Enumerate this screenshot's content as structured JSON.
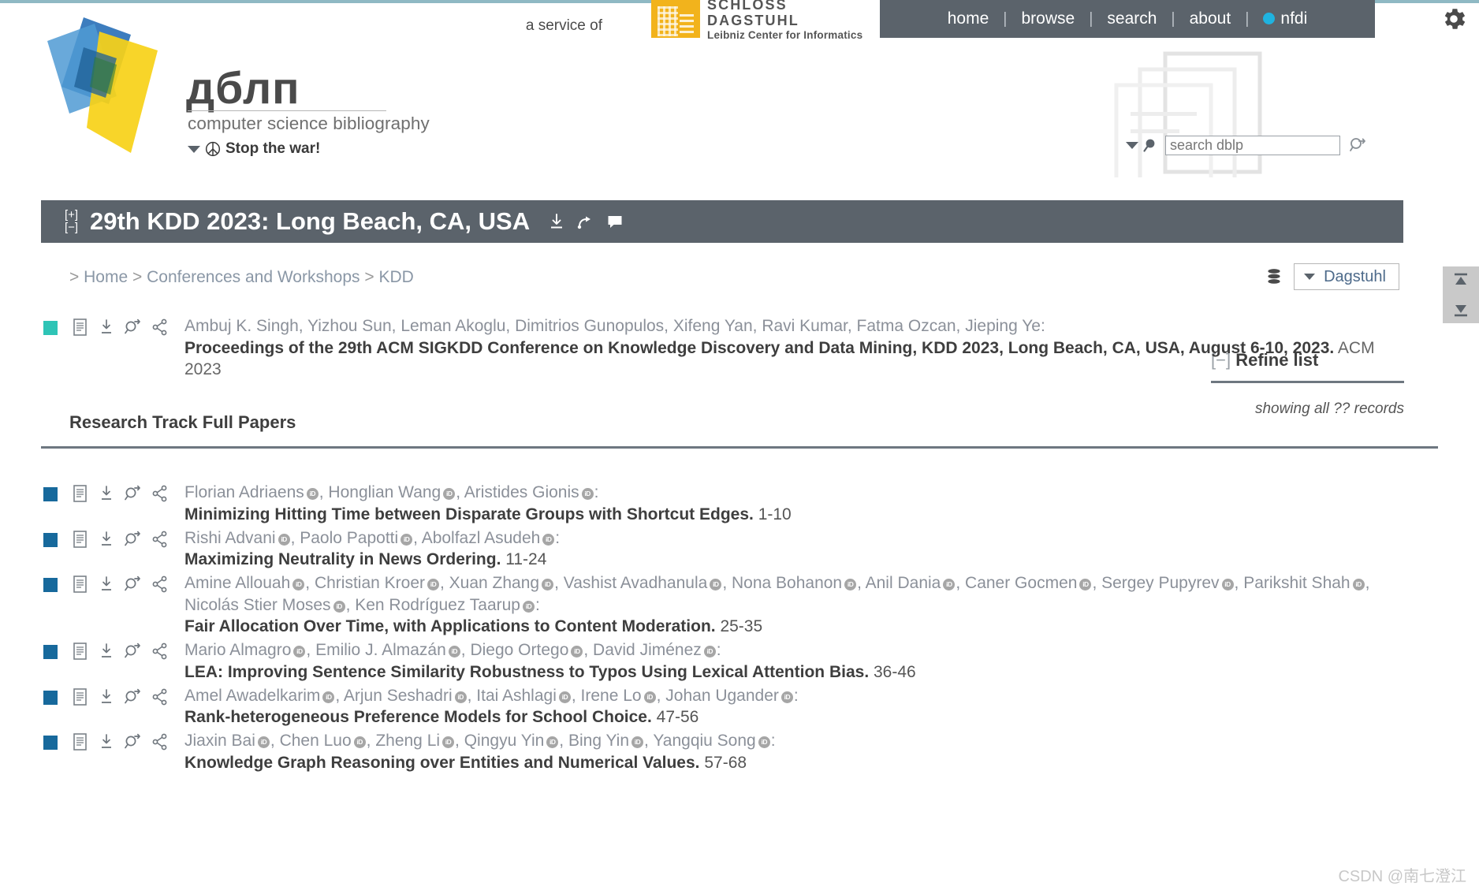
{
  "header": {
    "service_of": "a service of",
    "dagstuhl_line1": "SCHLOSS DAGSTUHL",
    "dagstuhl_line2": "Leibniz Center for Informatics",
    "nav": [
      {
        "label": "home"
      },
      {
        "label": "browse"
      },
      {
        "label": "search"
      },
      {
        "label": "about"
      },
      {
        "label": "nfdi"
      }
    ],
    "nav_separator": "|",
    "gear_icon": "gear-icon",
    "nfdi_dot_color": "#1fb3e0",
    "nav_background": "#5b636b"
  },
  "logo": {
    "wordmark": "дблп",
    "subtitle": "computer science bibliography",
    "banner": "Stop the war!"
  },
  "search": {
    "placeholder": "search dblp",
    "value": ""
  },
  "title_bar": {
    "expand": "[+]",
    "collapse": "[−]",
    "title": "29th KDD 2023: Long Beach, CA, USA",
    "icons": [
      "download-icon",
      "share-arrow-icon",
      "comment-icon"
    ],
    "background": "#5b636b"
  },
  "breadcrumb": {
    "prefix": ">",
    "items": [
      "Home",
      "Conferences and Workshops",
      "KDD"
    ],
    "separator": ">"
  },
  "db_selector": {
    "icon": "database-icon",
    "label": "Dagstuhl"
  },
  "scroll_widget": {
    "top_label": "scroll-to-top-icon",
    "bottom_label": "scroll-to-bottom-icon"
  },
  "refine_panel": {
    "toggle": "[−]",
    "title": "Refine list",
    "note": "showing all ?? records"
  },
  "section": {
    "title": "Research Track Full Papers"
  },
  "proceedings": {
    "marker_color": "#2ec4b6",
    "authors": [
      "Ambuj K. Singh",
      "Yizhou Sun",
      "Leman Akoglu",
      "Dimitrios Gunopulos",
      "Xifeng Yan",
      "Ravi Kumar",
      "Fatma Ozcan",
      "Jieping Ye"
    ],
    "authors_text": "Ambuj K. Singh, Yizhou Sun, Leman Akoglu, Dimitrios Gunopulos, Xifeng Yan, Ravi Kumar, Fatma Ozcan, Jieping Ye:",
    "title": "Proceedings of the 29th ACM SIGKDD Conference on Knowledge Discovery and Data Mining, KDD 2023, Long Beach, CA, USA, August 6-10, 2023.",
    "venue": "ACM 2023"
  },
  "entries": [
    {
      "marker_color": "#17699c",
      "authors": [
        {
          "name": "Florian Adriaens",
          "orcid": true
        },
        {
          "name": "Honglian Wang",
          "orcid": true
        },
        {
          "name": "Aristides Gionis",
          "orcid": true
        }
      ],
      "title": "Minimizing Hitting Time between Disparate Groups with Shortcut Edges.",
      "pages": "1-10"
    },
    {
      "marker_color": "#17699c",
      "authors": [
        {
          "name": "Rishi Advani",
          "orcid": true
        },
        {
          "name": "Paolo Papotti",
          "orcid": true
        },
        {
          "name": "Abolfazl Asudeh",
          "orcid": true
        }
      ],
      "title": "Maximizing Neutrality in News Ordering.",
      "pages": "11-24"
    },
    {
      "marker_color": "#17699c",
      "authors": [
        {
          "name": "Amine Allouah",
          "orcid": true
        },
        {
          "name": "Christian Kroer",
          "orcid": true
        },
        {
          "name": "Xuan Zhang",
          "orcid": true
        },
        {
          "name": "Vashist Avadhanula",
          "orcid": true
        },
        {
          "name": "Nona Bohanon",
          "orcid": true
        },
        {
          "name": "Anil Dania",
          "orcid": true
        },
        {
          "name": "Caner Gocmen",
          "orcid": true
        },
        {
          "name": "Sergey Pupyrev",
          "orcid": true
        },
        {
          "name": "Parikshit Shah",
          "orcid": true
        },
        {
          "name": "Nicolás Stier Moses",
          "orcid": true
        },
        {
          "name": "Ken Rodríguez Taarup",
          "orcid": true
        }
      ],
      "title": "Fair Allocation Over Time, with Applications to Content Moderation.",
      "pages": "25-35"
    },
    {
      "marker_color": "#17699c",
      "authors": [
        {
          "name": "Mario Almagro",
          "orcid": true
        },
        {
          "name": "Emilio J. Almazán",
          "orcid": true
        },
        {
          "name": "Diego Ortego",
          "orcid": true
        },
        {
          "name": "David Jiménez",
          "orcid": true
        }
      ],
      "title": "LEA: Improving Sentence Similarity Robustness to Typos Using Lexical Attention Bias.",
      "pages": "36-46"
    },
    {
      "marker_color": "#17699c",
      "authors": [
        {
          "name": "Amel Awadelkarim",
          "orcid": true
        },
        {
          "name": "Arjun Seshadri",
          "orcid": true
        },
        {
          "name": "Itai Ashlagi",
          "orcid": true
        },
        {
          "name": "Irene Lo",
          "orcid": true
        },
        {
          "name": "Johan Ugander",
          "orcid": true
        }
      ],
      "title": "Rank-heterogeneous Preference Models for School Choice.",
      "pages": "47-56"
    },
    {
      "marker_color": "#17699c",
      "authors": [
        {
          "name": "Jiaxin Bai",
          "orcid": true
        },
        {
          "name": "Chen Luo",
          "orcid": true
        },
        {
          "name": "Zheng Li",
          "orcid": true
        },
        {
          "name": "Qingyu Yin",
          "orcid": true
        },
        {
          "name": "Bing Yin",
          "orcid": true
        },
        {
          "name": "Yangqiu Song",
          "orcid": true
        }
      ],
      "title": "Knowledge Graph Reasoning over Entities and Numerical Values.",
      "pages": "57-68"
    }
  ],
  "entry_icons": [
    "bibtex-page-icon",
    "download-icon",
    "search-arrow-icon",
    "share-icon"
  ],
  "orcid_label": "iD",
  "watermark": "CSDN @南七澄江"
}
